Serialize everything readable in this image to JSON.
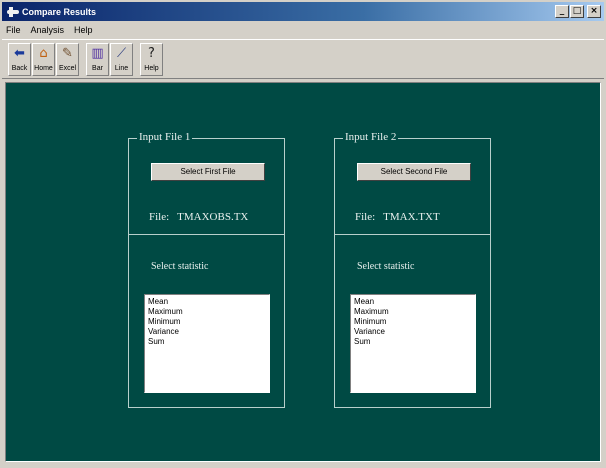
{
  "window": {
    "title": "Compare Results",
    "controls": {
      "minimize": "_",
      "maximize": "□",
      "close": "×"
    }
  },
  "menu": [
    "File",
    "Analysis",
    "Help"
  ],
  "toolbar": [
    {
      "label": "Back",
      "icon": "back-arrow-icon",
      "glyph": "⬅"
    },
    {
      "label": "Home",
      "icon": "home-icon",
      "glyph": "⌂"
    },
    {
      "label": "Excel",
      "icon": "excel-icon",
      "glyph": "✎"
    },
    {
      "label": "Bar",
      "icon": "bar-chart-icon",
      "glyph": "▥"
    },
    {
      "label": "Line",
      "icon": "line-chart-icon",
      "glyph": "⟋"
    },
    {
      "label": "Help",
      "icon": "help-icon",
      "glyph": "?"
    }
  ],
  "panel1": {
    "title": "Input File 1",
    "button": "Select First File",
    "file_prefix": "File:",
    "file_name": "TMAXOBS.TX",
    "stat_label": "Select statistic",
    "options": [
      "Mean",
      "Maximum",
      "Minimum",
      "Variance",
      "Sum"
    ]
  },
  "panel2": {
    "title": "Input File 2",
    "button": "Select Second File",
    "file_prefix": "File:",
    "file_name": "TMAX.TXT",
    "stat_label": "Select statistic",
    "options": [
      "Mean",
      "Maximum",
      "Minimum",
      "Variance",
      "Sum"
    ]
  },
  "colors": {
    "client_background": "#004a44",
    "group_border": "#b8d0cc",
    "title_bar": "#0a246a"
  }
}
